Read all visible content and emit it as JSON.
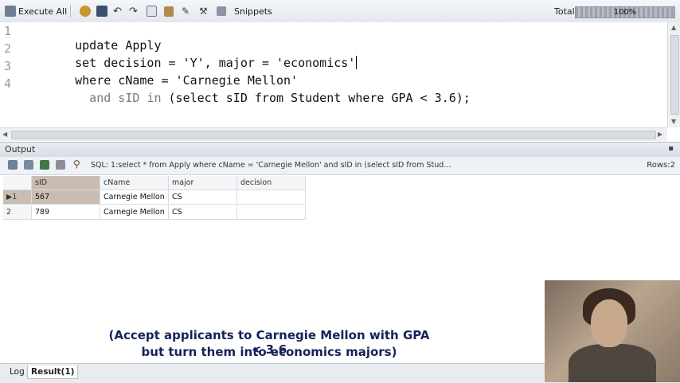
{
  "toolbar": {
    "execute_label": "Execute All",
    "snippets_label": "Snippets",
    "total_label": "Total",
    "progress_text": "100%",
    "progress_fraction": 1.0,
    "icons": [
      "run-icon",
      "open-icon",
      "save-icon",
      "undo-icon",
      "redo-icon",
      "copy-icon",
      "paste-icon",
      "clear-icon",
      "tools-icon",
      "format-icon",
      "snippets-icon"
    ]
  },
  "editor": {
    "line_numbers": [
      "1",
      "2",
      "3",
      "4"
    ],
    "lines": [
      [
        {
          "t": "update Apply",
          "c": "kw"
        }
      ],
      [
        {
          "t": "set decision = 'Y', major = 'economics'",
          "c": "kw"
        }
      ],
      [
        {
          "t": "where cName = 'Carnegie Mellon'",
          "c": "kw"
        }
      ],
      [
        {
          "t": "  and sID ",
          "c": "dim"
        },
        {
          "t": "in",
          "c": "dim"
        },
        {
          "t": " (select sID from Student where GPA < 3.6);",
          "c": "kw"
        }
      ]
    ]
  },
  "output": {
    "title": "Output",
    "sql": "SQL: 1:select * from Apply  where cName = 'Carnegie Mellon'    and sID in (select sID from Stud...",
    "rows_label": "Rows:2"
  },
  "grid": {
    "columns": [
      "sID",
      "cName",
      "major",
      "decision"
    ],
    "rows": [
      {
        "n": "1",
        "cells": [
          "567",
          "Carnegie Mellon",
          "CS",
          ""
        ]
      },
      {
        "n": "2",
        "cells": [
          "789",
          "Carnegie Mellon",
          "CS",
          ""
        ]
      }
    ]
  },
  "tabs": [
    "Log",
    "Result(1)"
  ],
  "caption": {
    "line1": "(Accept applicants to Carnegie Mellon with GPA < 3.6",
    "line2": "but turn them into economics majors)"
  },
  "colors": {
    "caption": "#17225a",
    "keyword": "#111111",
    "dimmed": "#7a7a7a"
  }
}
